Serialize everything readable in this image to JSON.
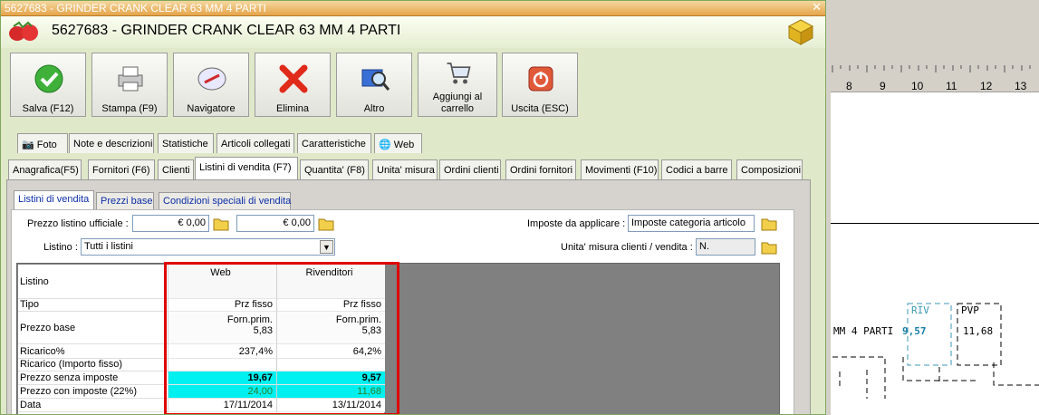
{
  "window": {
    "title_bar": "5627683 - GRINDER CRANK CLEAR 63 MM 4 PARTI",
    "header_title": "5627683 - GRINDER CRANK CLEAR 63 MM 4 PARTI",
    "close_glyph": "✕"
  },
  "toolbar": [
    {
      "label": "Salva (F12)",
      "icon": "check-icon"
    },
    {
      "label": "Stampa (F9)",
      "icon": "printer-icon"
    },
    {
      "label": "Navigatore",
      "icon": "compass-icon"
    },
    {
      "label": "Elimina",
      "icon": "delete-x-icon"
    },
    {
      "label": "Altro",
      "icon": "search-book-icon"
    },
    {
      "label": "Aggiungi al carrello",
      "icon": "cart-icon"
    },
    {
      "label": "Uscita (ESC)",
      "icon": "exit-icon"
    }
  ],
  "tabs_row1": [
    "Foto",
    "Note e descrizioni",
    "Statistiche",
    "Articoli collegati",
    "Caratteristiche",
    "Web"
  ],
  "tabs_row2": [
    "Anagrafica(F5)",
    "Fornitori (F6)",
    "Clienti",
    "Listini di vendita (F7)",
    "Quantita' (F8)",
    "Unita' misura",
    "Ordini clienti",
    "Ordini fornitori",
    "Movimenti (F10)",
    "Codici a barre",
    "Composizioni"
  ],
  "selected_tab": "Listini di vendita (F7)",
  "subtabs": [
    "Listini di vendita",
    "Prezzi base",
    "Condizioni speciali di vendita"
  ],
  "form": {
    "prezzo_listino_label": "Prezzo listino ufficiale :",
    "prezzo_value_1": "€ 0,00",
    "prezzo_value_2": "€ 0,00",
    "imposte_label": "Imposte da applicare :",
    "imposte_value": "Imposte categoria articolo",
    "listino_label": "Listino :",
    "listino_value": "Tutti i listini",
    "unita_label": "Unita' misura clienti / vendita :",
    "unita_value": "N."
  },
  "grid": {
    "columns": [
      "Web",
      "Rivenditori"
    ],
    "header_row_label": "Listino",
    "rows": [
      {
        "label": "Tipo",
        "web": "Prz fisso",
        "riv": "Prz fisso"
      },
      {
        "label": "Prezzo base",
        "web": "Forn.prim.",
        "riv": "Forn.prim.",
        "web2": "5,83",
        "riv2": "5,83"
      },
      {
        "label": "Ricarico%",
        "web": "237,4%",
        "riv": "64,2%"
      },
      {
        "label": "Ricarico (Importo fisso)",
        "web": "",
        "riv": ""
      },
      {
        "label": "Prezzo senza imposte",
        "web": "19,67",
        "riv": "9,57"
      },
      {
        "label": "Prezzo con imposte (22%)",
        "web": "24,00",
        "riv": "11,68"
      },
      {
        "label": "Data",
        "web": "17/11/2014",
        "riv": "13/11/2014"
      }
    ]
  },
  "right_panel": {
    "ruler_numbers": [
      "8",
      "9",
      "10",
      "11",
      "12",
      "13"
    ],
    "label_riv": "RIV",
    "label_pvp": "PVP",
    "text_fragment": "MM 4 PARTI",
    "riv_value": "9,57",
    "pvp_value": "11,68"
  },
  "colors": {
    "highlight_cyan": "#00f0f0",
    "red_box": "#e00000",
    "window_bg": "#dfe8c8"
  }
}
